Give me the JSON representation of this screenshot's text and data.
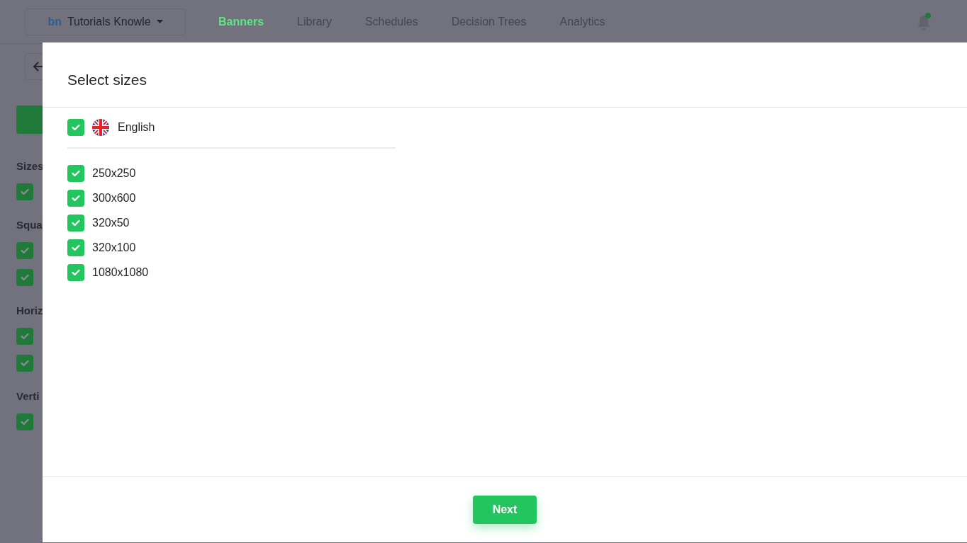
{
  "header": {
    "logo": "bn",
    "workspace": "Tutorials Knowle",
    "tabs": [
      {
        "label": "Banners",
        "selected": true
      },
      {
        "label": "Library",
        "selected": false
      },
      {
        "label": "Schedules",
        "selected": false
      },
      {
        "label": "Decision Trees",
        "selected": false
      },
      {
        "label": "Analytics",
        "selected": false
      }
    ]
  },
  "sidebar": {
    "sections": [
      {
        "title": "Sizes",
        "items": [
          {
            "checked": true
          }
        ]
      },
      {
        "title": "Squa",
        "items": [
          {
            "checked": true
          },
          {
            "checked": true
          }
        ]
      },
      {
        "title": "Horiz",
        "items": [
          {
            "checked": true
          },
          {
            "checked": true
          }
        ]
      },
      {
        "title": "Verti",
        "items": [
          {
            "checked": true
          }
        ]
      }
    ]
  },
  "modal": {
    "title": "Select sizes",
    "language": {
      "label": "English",
      "checked": true
    },
    "sizes": [
      {
        "label": "250x250",
        "checked": true
      },
      {
        "label": "300x600",
        "checked": true
      },
      {
        "label": "320x50",
        "checked": true
      },
      {
        "label": "320x100",
        "checked": true
      },
      {
        "label": "1080x1080",
        "checked": true
      }
    ],
    "next_button": "Next"
  }
}
